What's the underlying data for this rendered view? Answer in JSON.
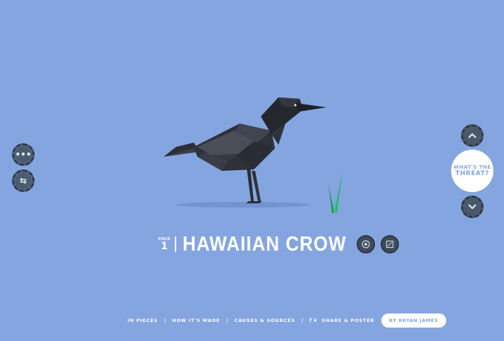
{
  "left_controls": {
    "menu_icon": "ellipsis-icon",
    "menu_glyph": "•••",
    "refresh_icon": "refresh-icon",
    "refresh_glyph": "⇆"
  },
  "right_controls": {
    "up_icon": "chevron-up-icon",
    "up_glyph": "⌃",
    "threat_line1": "WHAT'S THE",
    "threat_line2": "THREAT?",
    "down_icon": "chevron-down-icon",
    "down_glyph": "⌄"
  },
  "title": {
    "piece_label": "PIECE",
    "piece_number": "1",
    "species": "HAWAIIAN CROW"
  },
  "footer": {
    "links": [
      "IN PIECES",
      "HOW IT'S MADE",
      "CAUSES & SOURCES"
    ],
    "social_icons": "f ❦",
    "share_label": "SHARE & POSTER",
    "author": "BY BRYAN JAMES"
  },
  "colors": {
    "background": "#84a5e0",
    "button_dark": "#4a5869",
    "bird": "#2a2d35",
    "grass": "#2aa865"
  }
}
